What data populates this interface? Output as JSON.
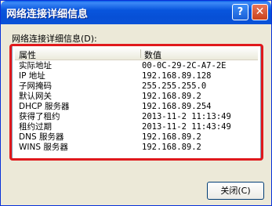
{
  "window": {
    "title": "网络连接详细信息",
    "help_label": "?",
    "close_label": "✕"
  },
  "group_label": "网络连接详细信息(D):",
  "list": {
    "headers": [
      "属性",
      "数值"
    ],
    "rows": [
      {
        "name": "实际地址",
        "value": "00-0C-29-2C-A7-2E"
      },
      {
        "name": "IP 地址",
        "value": "192.168.89.128"
      },
      {
        "name": "子网掩码",
        "value": "255.255.255.0"
      },
      {
        "name": "默认网关",
        "value": "192.168.89.2"
      },
      {
        "name": "DHCP 服务器",
        "value": "192.168.89.254"
      },
      {
        "name": "获得了租约",
        "value": "2013-11-2 11:13:49"
      },
      {
        "name": "租约过期",
        "value": "2013-11-2 11:43:49"
      },
      {
        "name": "DNS 服务器",
        "value": "192.168.89.2"
      },
      {
        "name": "WINS 服务器",
        "value": "192.168.89.2"
      }
    ]
  },
  "close_button": "关闭(C)",
  "colors": {
    "titlebar": "#0855dd",
    "highlight": "#e0191c",
    "dialog_bg": "#ece9d8"
  }
}
